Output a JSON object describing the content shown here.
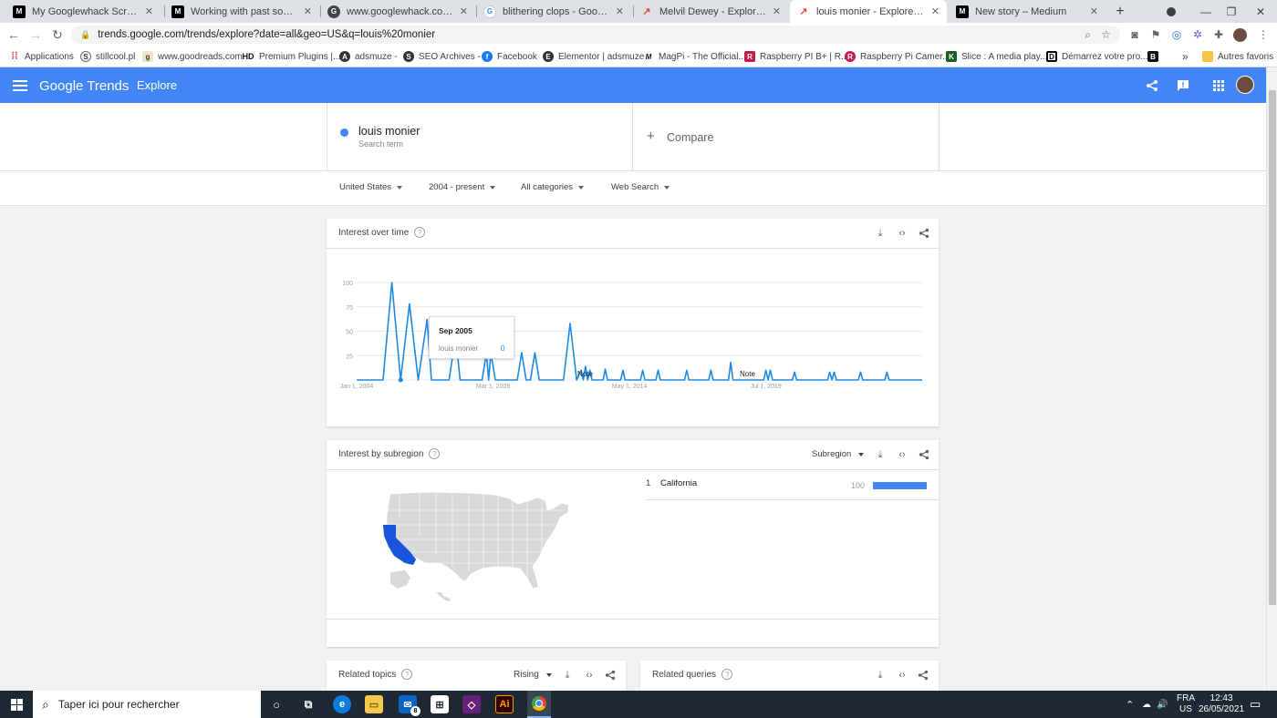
{
  "browser": {
    "tabs": [
      {
        "title": "My Googlewhack Scraper. I rece",
        "favicon": "M"
      },
      {
        "title": "Working with past social data ab",
        "favicon": "M"
      },
      {
        "title": "www.googlewhack.com/tally.pl",
        "favicon": "G"
      },
      {
        "title": "blithering clops - Google Search",
        "favicon": "G"
      },
      {
        "title": "Melvil Dewey - Explore - Google",
        "favicon": "T"
      },
      {
        "title": "louis monier - Explore - Google",
        "favicon": "T"
      },
      {
        "title": "New story – Medium",
        "favicon": "M"
      }
    ],
    "new_tab": "+",
    "url": "trends.google.com/trends/explore?date=all&geo=US&q=louis%20monier",
    "bookmarks": [
      {
        "label": "Applications",
        "icon": "apps-grid"
      },
      {
        "label": "stillcool.pl",
        "icon": "S"
      },
      {
        "label": "www.goodreads.com",
        "icon": "g"
      },
      {
        "label": "Premium Plugins |...",
        "icon": "HD"
      },
      {
        "label": "adsmuze -",
        "icon": "A"
      },
      {
        "label": "SEO Archives -",
        "icon": "S"
      },
      {
        "label": "Facebook",
        "icon": "f"
      },
      {
        "label": "Elementor | adsmuze",
        "icon": "E"
      },
      {
        "label": "MagPi - The Official...",
        "icon": "M"
      },
      {
        "label": "Raspberry PI B+ | R...",
        "icon": "R"
      },
      {
        "label": "Raspberry Pi Camer...",
        "icon": "R"
      },
      {
        "label": "Slice : A media play...",
        "icon": "K"
      },
      {
        "label": "Démarrez votre pro...",
        "icon": "D"
      },
      {
        "label": "",
        "icon": "B"
      }
    ],
    "bookmarks_more": "»",
    "other_bookmarks": "Autres favoris"
  },
  "header": {
    "logo": "Google Trends",
    "page": "Explore"
  },
  "search": {
    "term": "louis monier",
    "term_sub": "Search term",
    "compare": "Compare"
  },
  "filters": {
    "region": "United States",
    "time": "2004 - present",
    "category": "All categories",
    "property": "Web Search"
  },
  "interest_over_time": {
    "title": "Interest over time",
    "tooltip": {
      "date": "Sep 2005",
      "label": "louis monier",
      "value": "0"
    },
    "notes": [
      "Note",
      "Note"
    ]
  },
  "chart_data": {
    "type": "line",
    "title": "Interest over time",
    "xlabel": "",
    "ylabel": "",
    "ylim": [
      0,
      100
    ],
    "yticks": [
      "100",
      "75",
      "50",
      "25"
    ],
    "xticks": [
      "Jan 1, 2004",
      "Mar 1, 2009",
      "May 1, 2014",
      "Jul 1, 2019"
    ],
    "grid": true,
    "series": [
      {
        "name": "louis monier",
        "color": "#1e88e5",
        "points": [
          [
            "2004-01",
            0
          ],
          [
            "2005-01",
            0
          ],
          [
            "2005-05",
            100
          ],
          [
            "2005-09",
            0
          ],
          [
            "2006-01",
            78
          ],
          [
            "2006-05",
            0
          ],
          [
            "2006-09",
            62
          ],
          [
            "2006-11",
            0
          ],
          [
            "2007-07",
            0
          ],
          [
            "2007-10",
            45
          ],
          [
            "2007-12",
            0
          ],
          [
            "2008-10",
            0
          ],
          [
            "2008-12",
            28
          ],
          [
            "2009-01",
            0
          ],
          [
            "2009-02",
            28
          ],
          [
            "2009-04",
            0
          ],
          [
            "2010-02",
            0
          ],
          [
            "2010-04",
            28
          ],
          [
            "2010-06",
            0
          ],
          [
            "2010-08",
            0
          ],
          [
            "2010-10",
            28
          ],
          [
            "2010-12",
            0
          ],
          [
            "2011-11",
            0
          ],
          [
            "2012-02",
            58
          ],
          [
            "2012-05",
            0
          ],
          [
            "2012-07",
            10
          ],
          [
            "2012-08",
            0
          ],
          [
            "2012-09",
            14
          ],
          [
            "2012-10",
            0
          ],
          [
            "2012-11",
            10
          ],
          [
            "2012-12",
            0
          ],
          [
            "2013-05",
            0
          ],
          [
            "2013-06",
            11
          ],
          [
            "2013-07",
            0
          ],
          [
            "2014-01",
            0
          ],
          [
            "2014-02",
            10
          ],
          [
            "2014-03",
            0
          ],
          [
            "2014-10",
            0
          ],
          [
            "2014-11",
            10
          ],
          [
            "2014-12",
            0
          ],
          [
            "2015-05",
            0
          ],
          [
            "2015-06",
            10
          ],
          [
            "2015-07",
            0
          ],
          [
            "2016-06",
            0
          ],
          [
            "2016-07",
            10
          ],
          [
            "2016-08",
            0
          ],
          [
            "2017-05",
            0
          ],
          [
            "2017-06",
            10
          ],
          [
            "2017-07",
            0
          ],
          [
            "2018-02",
            0
          ],
          [
            "2018-03",
            18
          ],
          [
            "2018-04",
            0
          ],
          [
            "2019-06",
            0
          ],
          [
            "2019-07",
            10
          ],
          [
            "2019-08",
            0
          ],
          [
            "2019-09",
            10
          ],
          [
            "2019-10",
            0
          ],
          [
            "2020-07",
            0
          ],
          [
            "2020-08",
            8
          ],
          [
            "2020-09",
            0
          ],
          [
            "2021-11",
            0
          ],
          [
            "2021-12",
            8
          ],
          [
            "2022-01",
            0
          ],
          [
            "2022-02",
            8
          ],
          [
            "2022-03",
            0
          ],
          [
            "2023-01",
            0
          ],
          [
            "2023-02",
            8
          ],
          [
            "2023-03",
            0
          ],
          [
            "2024-01",
            0
          ],
          [
            "2024-02",
            8
          ],
          [
            "2024-03",
            0
          ],
          [
            "2025-06",
            0
          ]
        ]
      }
    ]
  },
  "subregion": {
    "title": "Interest by subregion",
    "selector": "Subregion",
    "rows": [
      {
        "rank": "1",
        "name": "California",
        "value": "100",
        "fill": 1.0
      }
    ],
    "map_highlight_color": "#1a56db",
    "map_base_color": "#d9d9d9"
  },
  "related_topics": {
    "title": "Related topics",
    "selector": "Rising"
  },
  "related_queries": {
    "title": "Related queries"
  },
  "taskbar": {
    "search_placeholder": "Taper ici pour rechercher",
    "mail_badge": "8",
    "lang": "FRA",
    "region": "US",
    "time": "12:43",
    "date": "26/05/2021"
  }
}
